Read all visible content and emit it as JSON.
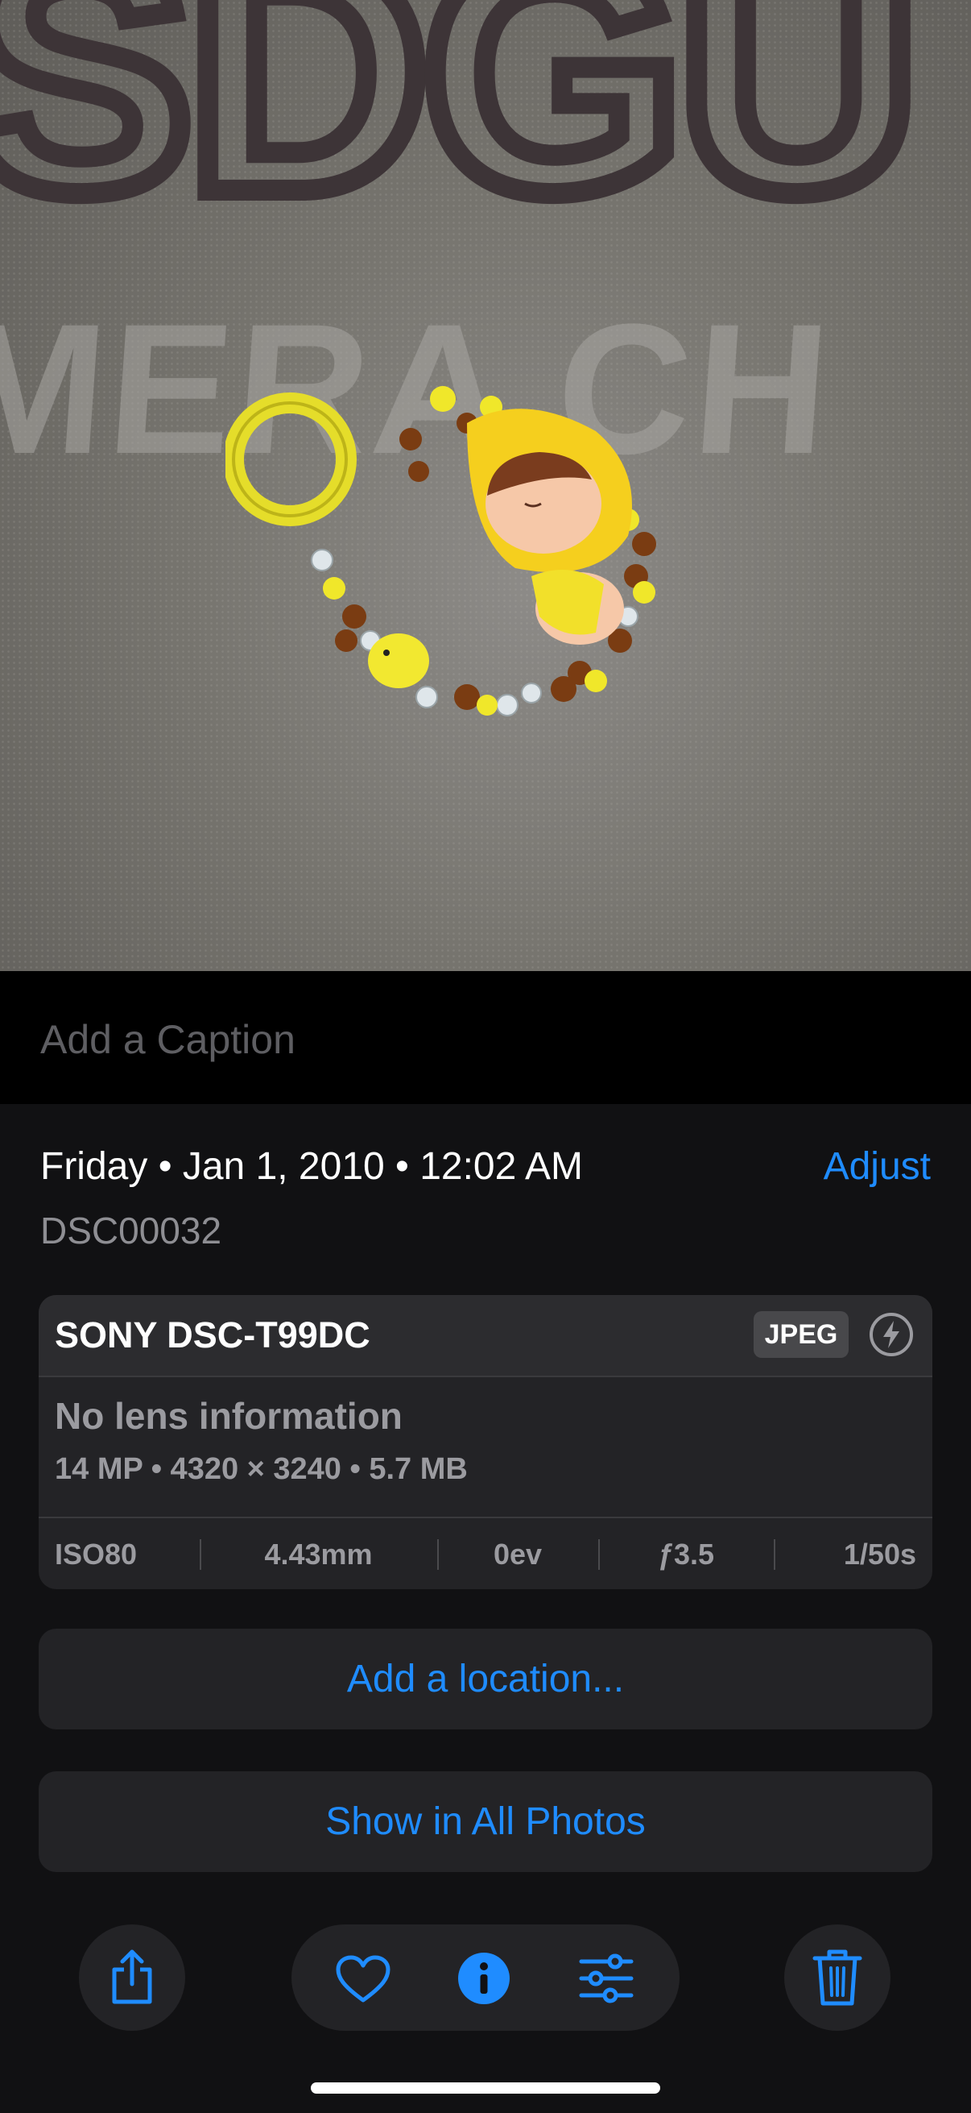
{
  "caption": {
    "placeholder": "Add a Caption"
  },
  "details": {
    "date": "Friday • Jan 1, 2010 • 12:02 AM",
    "adjust_label": "Adjust",
    "filename": "DSC00032"
  },
  "camera_card": {
    "camera": "SONY DSC-T99DC",
    "format": "JPEG",
    "lens": "No lens information",
    "specs": "14 MP • 4320 × 3240 • 5.7 MB",
    "exif": {
      "iso": "ISO80",
      "focal": "4.43mm",
      "ev": "0ev",
      "aperture": "ƒ3.5",
      "shutter": "1/50s"
    }
  },
  "buttons": {
    "add_location": "Add a location...",
    "show_all": "Show in All Photos"
  },
  "toolbar": {
    "icons": [
      "share-icon",
      "heart-icon",
      "info-icon",
      "adjust-sliders-icon",
      "trash-icon"
    ]
  },
  "colors": {
    "accent": "#1f8cff",
    "background": "#111113",
    "card": "#232326"
  }
}
